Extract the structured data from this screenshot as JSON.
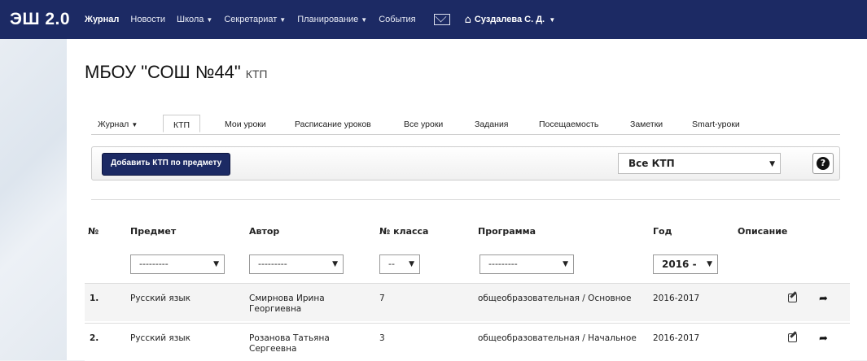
{
  "navbar": {
    "brand": "ЭШ 2.0",
    "items": [
      {
        "label": "Журнал",
        "active": true
      },
      {
        "label": "Новости"
      },
      {
        "label": "Школа",
        "dropdown": true
      },
      {
        "label": "Секретариат",
        "dropdown": true
      },
      {
        "label": "Планирование",
        "dropdown": true
      },
      {
        "label": "События"
      }
    ],
    "mail_icon": "envelope-icon",
    "home_icon": "home-icon",
    "user": "Суздалева С. Д."
  },
  "page": {
    "title": "МБОУ \"СОШ №44\"",
    "subtitle": "КТП"
  },
  "tabs": [
    {
      "label": "Журнал",
      "dropdown": true
    },
    {
      "label": "КТП",
      "active": true
    },
    {
      "label": "Мои уроки"
    },
    {
      "label": "Расписание уроков"
    },
    {
      "label": "Все уроки"
    },
    {
      "label": "Задания"
    },
    {
      "label": "Посещаемость"
    },
    {
      "label": "Заметки"
    },
    {
      "label": "Smart-уроки"
    }
  ],
  "toolbar": {
    "add_label": "Добавить КТП по предмету",
    "filter_value": "Все КТП",
    "help_label": "?"
  },
  "table": {
    "headers": [
      "№",
      "Предмет",
      "Автор",
      "№ класса",
      "Программа",
      "Год",
      "Описание"
    ],
    "filters": {
      "subject": "---------",
      "author": "---------",
      "class": "--",
      "program": "---------",
      "year": "2016 -"
    },
    "rows": [
      {
        "num": "1.",
        "subject": "Русский язык",
        "author_line1": "Смирнова Ирина",
        "author_line2": "Георгиевна",
        "class": "7",
        "program": "общеобразовательная / Основное",
        "year": "2016-2017"
      },
      {
        "num": "2.",
        "subject": "Русский язык",
        "author_line1": "Розанова Татьяна",
        "author_line2": "Сергеевна",
        "class": "3",
        "program": "общеобразовательная / Начальное",
        "year": "2016-2017"
      }
    ]
  },
  "colors": {
    "navbar": "#1c2a64",
    "button": "#1c2a64"
  }
}
